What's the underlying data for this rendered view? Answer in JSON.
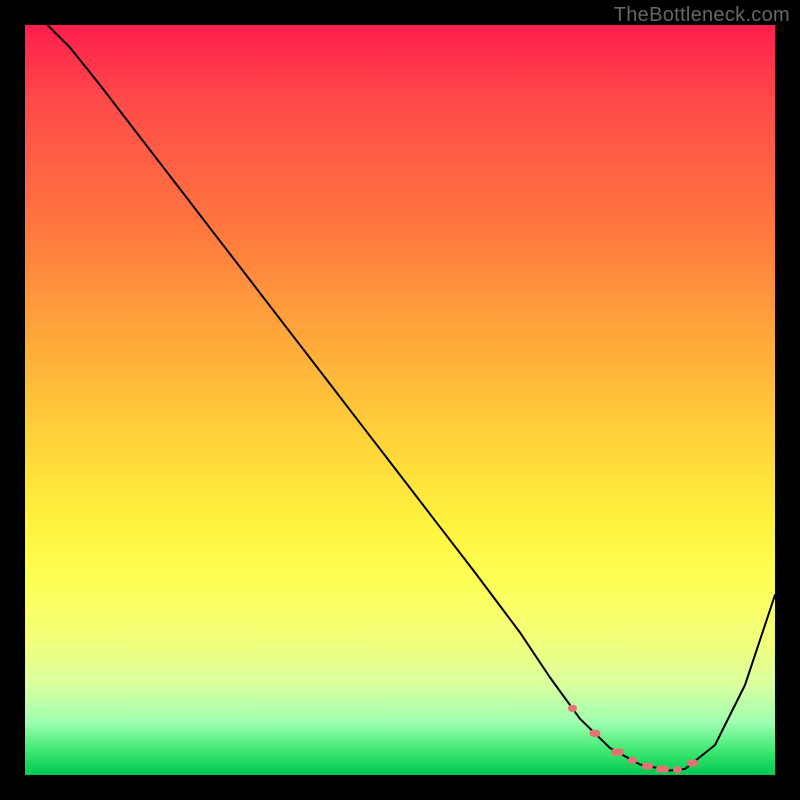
{
  "watermark": "TheBottleneck.com",
  "chart_data": {
    "type": "line",
    "title": "",
    "xlabel": "",
    "ylabel": "",
    "xlim": [
      0,
      100
    ],
    "ylim": [
      0,
      100
    ],
    "grid": false,
    "legend": false,
    "curve": {
      "x": [
        3,
        6,
        10,
        15,
        20,
        25,
        30,
        35,
        40,
        45,
        50,
        55,
        60,
        63,
        66,
        70,
        74,
        78,
        82,
        86,
        88,
        92,
        96,
        100
      ],
      "y": [
        100,
        97,
        92,
        85.5,
        79,
        72.5,
        66,
        59.5,
        53,
        46.5,
        40,
        33.5,
        27,
        23,
        19,
        13,
        7.5,
        3.6,
        1.4,
        0.6,
        0.8,
        4,
        12,
        24
      ]
    },
    "optimal_markers_x": [
      73,
      76,
      79,
      81,
      83,
      85,
      87,
      89
    ]
  },
  "colors": {
    "gradient_top": "#ff1e4c",
    "gradient_mid": "#fff23c",
    "gradient_bottom": "#00c853",
    "curve": "#000000",
    "marker": "#e57373",
    "frame_bg": "#ffffff",
    "page_bg": "#000000",
    "watermark": "#666666"
  }
}
